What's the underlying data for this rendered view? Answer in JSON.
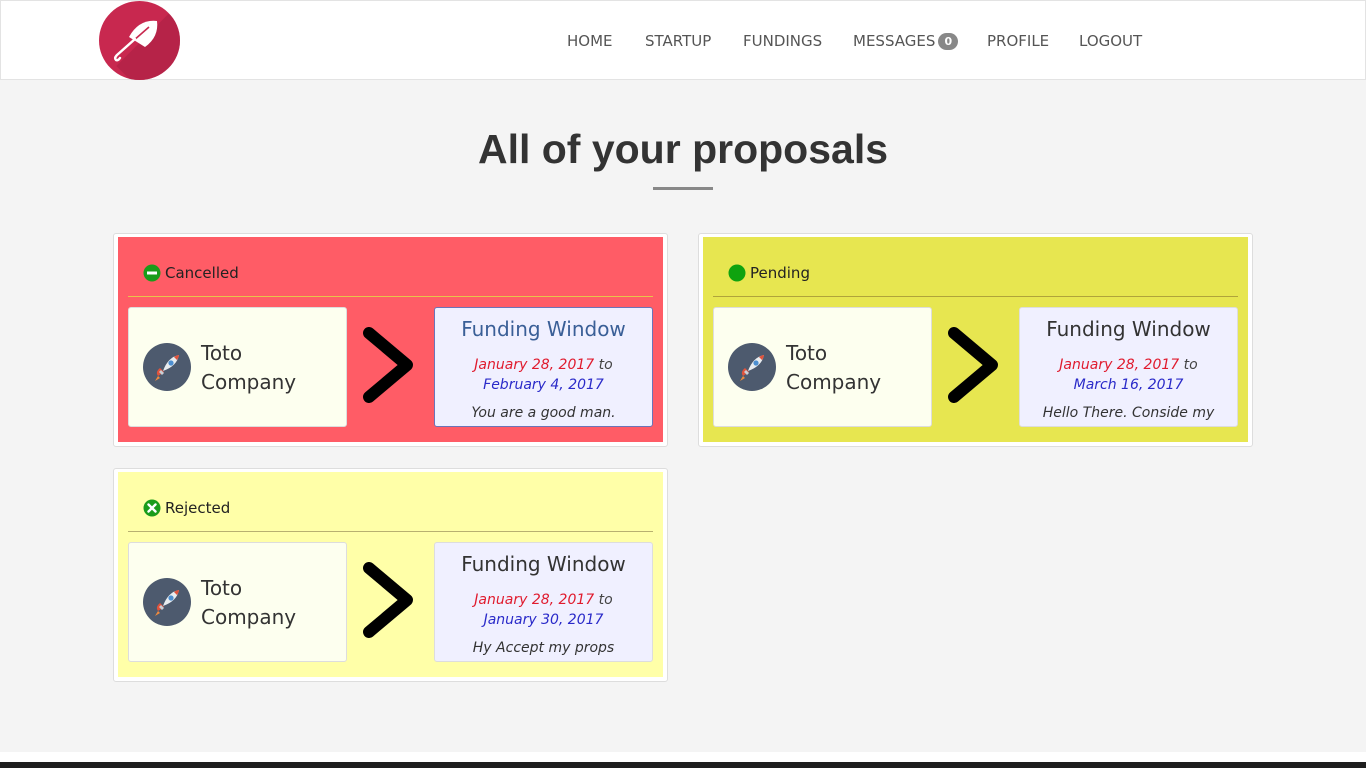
{
  "nav": {
    "logo_icon": "umbrella-icon",
    "items": [
      {
        "label": "HOME"
      },
      {
        "label": "STARTUP"
      },
      {
        "label": "FUNDINGS"
      },
      {
        "label": "MESSAGES",
        "badge": "0"
      },
      {
        "label": "PROFILE"
      },
      {
        "label": "LOGOUT"
      }
    ]
  },
  "page": {
    "title": "All of your proposals"
  },
  "proposals": [
    {
      "status": "Cancelled",
      "status_icon": "minus-circle-icon",
      "status_icon_color": "#1a9c1a",
      "background": "#ff5c66",
      "rule_color": "#e8c34a",
      "company": {
        "name": "Toto Company",
        "icon": "rocket-icon"
      },
      "arrow_icon": "chevron-right-icon",
      "window": {
        "title": "Funding Window",
        "start": "January 28, 2017",
        "to": "to",
        "end": "February 4, 2017",
        "message": "You are a good man."
      }
    },
    {
      "status": "Pending",
      "status_icon": "circle-icon",
      "status_icon_color": "#0fa30f",
      "background": "#e7e650",
      "rule_color": "#b0a43a",
      "company": {
        "name": "Toto Company",
        "icon": "rocket-icon"
      },
      "arrow_icon": "chevron-right-icon",
      "window": {
        "title": "Funding Window",
        "start": "January 28, 2017",
        "to": "to",
        "end": "March 16, 2017",
        "message": "Hello There. Conside my"
      }
    },
    {
      "status": "Rejected",
      "status_icon": "x-circle-icon",
      "status_icon_color": "#1a9c1a",
      "background": "#ffffa8",
      "rule_color": "#b8b070",
      "company": {
        "name": "Toto Company",
        "icon": "rocket-icon"
      },
      "arrow_icon": "chevron-right-icon",
      "window": {
        "title": "Funding Window",
        "start": "January 28, 2017",
        "to": "to",
        "end": "January 30, 2017",
        "message": "Hy Accept my props"
      }
    }
  ]
}
